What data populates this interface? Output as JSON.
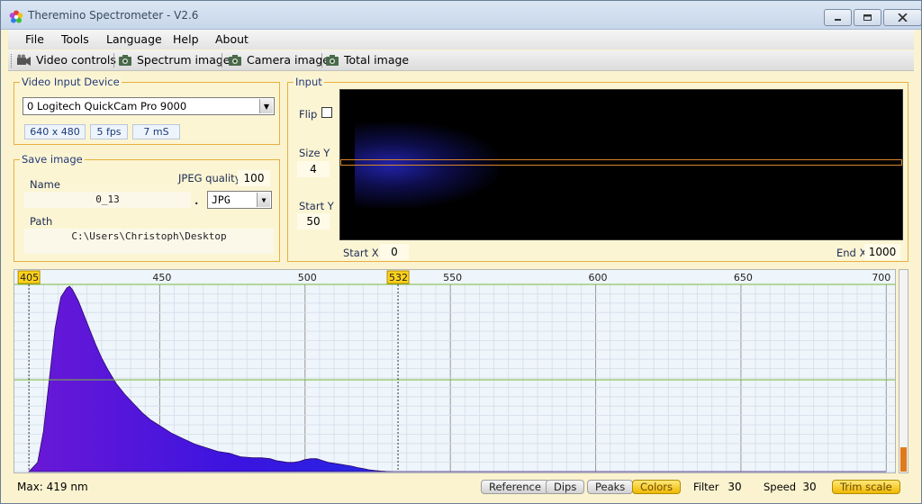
{
  "window": {
    "title": "Theremino Spectrometer - V2.6",
    "minimize_icon": "minimize-icon",
    "maximize_icon": "maximize-icon",
    "close_icon": "close-icon"
  },
  "menu": {
    "items": [
      "File",
      "Tools",
      "Language",
      "Help",
      "About"
    ]
  },
  "toolbar": {
    "items": [
      {
        "label": "Video controls",
        "icon": "video-camera-icon"
      },
      {
        "label": "Spectrum image",
        "icon": "camera-icon"
      },
      {
        "label": "Camera image",
        "icon": "camera-icon"
      },
      {
        "label": "Total image",
        "icon": "camera-icon"
      }
    ]
  },
  "video_input": {
    "title": "Video Input Device",
    "device": "0 Logitech QuickCam Pro 9000",
    "resolution": "640 x 480",
    "fps": "5 fps",
    "exposure": "7 mS"
  },
  "save_image": {
    "title": "Save image",
    "name_label": "Name",
    "name_value": "0_13",
    "dot": ".",
    "jpeg_quality_label": "JPEG quality",
    "jpeg_quality_value": "100",
    "format": "JPG",
    "path_label": "Path",
    "path_value": "C:\\Users\\Christoph\\Desktop"
  },
  "input": {
    "title": "Input",
    "flip_label": "Flip",
    "flip_checked": false,
    "size_y_label": "Size Y",
    "size_y_value": "4",
    "start_y_label": "Start Y",
    "start_y_value": "50",
    "start_x_label": "Start X",
    "start_x_value": "0",
    "end_x_label": "End X",
    "end_x_value": "1000"
  },
  "chart_data": {
    "type": "area",
    "x_range": [
      400,
      703
    ],
    "x_tick_labels": [
      "450",
      "500",
      "550",
      "600",
      "650",
      "700"
    ],
    "x_ticks": [
      450,
      500,
      550,
      600,
      650,
      700
    ],
    "markers": [
      {
        "label": "405",
        "x": 405
      },
      {
        "label": "532",
        "x": 532
      }
    ],
    "grid": true,
    "y_range": [
      0,
      1
    ],
    "reference_line_y": 0.5,
    "series": [
      {
        "x": [
          405,
          408,
          410,
          412,
          414,
          416,
          418,
          419,
          420,
          422,
          424,
          426,
          428,
          430,
          432,
          435,
          438,
          441,
          444,
          447,
          450,
          454,
          458,
          462,
          466,
          470,
          474,
          478,
          482,
          485,
          488,
          490,
          492,
          494,
          496,
          498,
          500,
          502,
          504,
          506,
          508,
          510,
          512,
          514,
          516,
          518,
          520,
          522,
          524,
          526,
          528,
          530,
          532,
          540,
          560,
          600,
          650,
          700
        ],
        "y": [
          0.0,
          0.05,
          0.22,
          0.5,
          0.78,
          0.95,
          1.0,
          1.01,
          0.99,
          0.93,
          0.85,
          0.77,
          0.69,
          0.62,
          0.56,
          0.48,
          0.42,
          0.37,
          0.32,
          0.28,
          0.25,
          0.21,
          0.18,
          0.15,
          0.13,
          0.11,
          0.1,
          0.08,
          0.075,
          0.075,
          0.07,
          0.06,
          0.055,
          0.05,
          0.05,
          0.055,
          0.065,
          0.07,
          0.07,
          0.06,
          0.05,
          0.045,
          0.04,
          0.035,
          0.03,
          0.022,
          0.016,
          0.01,
          0.006,
          0.003,
          0.001,
          0.0,
          0.0,
          0.0,
          0.0,
          0.0,
          0.0,
          0.0
        ]
      }
    ]
  },
  "status": {
    "max_text": "Max: 419 nm",
    "buttons": [
      {
        "label": "Reference",
        "active": false
      },
      {
        "label": "Dips",
        "active": false
      },
      {
        "label": "Peaks",
        "active": false
      },
      {
        "label": "Colors",
        "active": true
      }
    ],
    "filter_label": "Filter",
    "filter_value": "30",
    "speed_label": "Speed",
    "speed_value": "30",
    "trim_label": "Trim scale",
    "level": 0.12,
    "level_color": "#e07a1a"
  }
}
